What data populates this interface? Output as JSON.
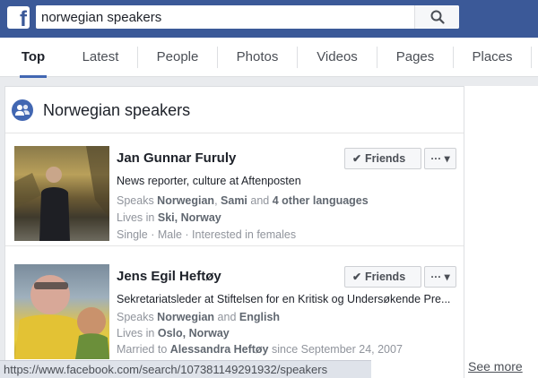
{
  "topbar": {
    "logo_letter": "f",
    "search": {
      "value": "norwegian speakers",
      "placeholder": "Search"
    }
  },
  "tabs": [
    {
      "label": "Top",
      "active": true
    },
    {
      "label": "Latest",
      "active": false
    },
    {
      "label": "People",
      "active": false
    },
    {
      "label": "Photos",
      "active": false
    },
    {
      "label": "Videos",
      "active": false
    },
    {
      "label": "Pages",
      "active": false
    },
    {
      "label": "Places",
      "active": false
    }
  ],
  "results_card": {
    "title": "Norwegian speakers",
    "icon": "people-group-icon"
  },
  "results": [
    {
      "name": "Jan Gunnar Furuly",
      "headline": "News reporter, culture at Aftenposten",
      "speaks_prefix": "Speaks ",
      "speaks_lang1": "Norwegian",
      "speaks_sep1": ", ",
      "speaks_lang2": "Sami",
      "speaks_sep2": " and ",
      "speaks_lang3": "4 other languages",
      "lives_prefix": "Lives in ",
      "lives_place": "Ski, Norway",
      "extra": "Single · Male · Interested in females",
      "friends_label": "Friends",
      "more_label": "···"
    },
    {
      "name": "Jens Egil Heftøy",
      "headline": "Sekretariatsleder at Stiftelsen for en Kritisk og Undersøkende Pre...",
      "speaks_prefix": "Speaks ",
      "speaks_lang1": "Norwegian",
      "speaks_sep1": " and ",
      "speaks_lang2": "English",
      "lives_prefix": "Lives in ",
      "lives_place": "Oslo, Norway",
      "married_prefix": "Married to ",
      "married_name": "Alessandra Heftøy",
      "married_suffix": " since September 24, 2007",
      "friends_label": "Friends",
      "more_label": "···"
    }
  ],
  "statusbar": {
    "url": "https://www.facebook.com/search/107381149291932/speakers"
  },
  "see_more": "See more",
  "colors": {
    "brand": "#3b5998",
    "accent": "#4267b2",
    "muted_text": "#90949c"
  }
}
